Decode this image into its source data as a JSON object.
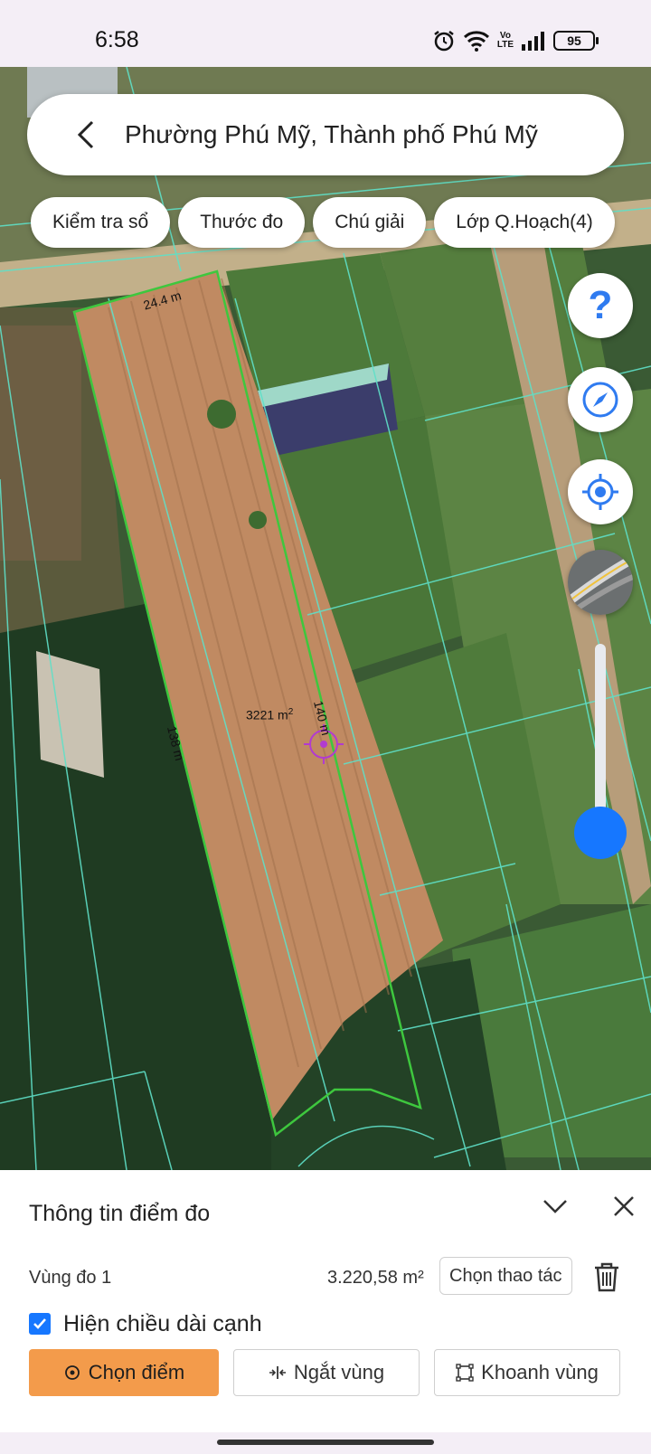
{
  "status": {
    "time": "6:58",
    "battery": "95",
    "volte_top": "Vo",
    "volte_bottom": "LTE"
  },
  "search": {
    "title": "Phường Phú Mỹ, Thành phố Phú Mỹ"
  },
  "chips": [
    "Kiểm tra sổ",
    "Thước đo",
    "Chú giải",
    "Lớp Q.Hoạch(4)"
  ],
  "map": {
    "edge_top": "24.4 m",
    "edge_left": "138 m",
    "edge_right": "140 m",
    "area_value": "3221 m",
    "area_sup": "2",
    "zoom_level": 0.15
  },
  "panel": {
    "title": "Thông tin điểm đo",
    "zone_name": "Vùng đo 1",
    "zone_area": "3.220,58 m²",
    "action_label": "Chọn thao tác",
    "checkbox_label": "Hiện chiều dài cạnh",
    "checkbox_checked": true,
    "buttons": {
      "pick_point": "Chọn điểm",
      "split_zone": "Ngắt vùng",
      "draw_zone": "Khoanh vùng"
    }
  },
  "colors": {
    "accent": "#1677ff",
    "primary_button": "#f39b4b",
    "parcel_line": "#3ec73e",
    "cadastral_line": "#5fe0c8",
    "marker": "#b23bd0"
  }
}
